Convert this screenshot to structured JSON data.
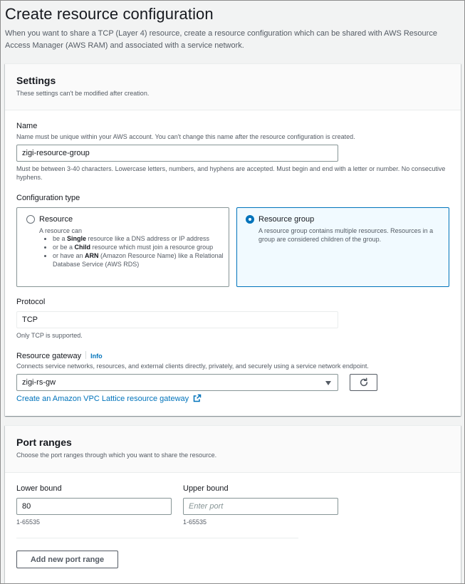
{
  "page": {
    "title": "Create resource configuration",
    "description": "When you want to share a TCP (Layer 4) resource, create a resource configuration which can be shared with AWS Resource Access Manager (AWS RAM) and associated with a service network."
  },
  "settings": {
    "title": "Settings",
    "subtitle": "These settings can't be modified after creation.",
    "name": {
      "label": "Name",
      "description": "Name must be unique within your AWS account. You can't change this name after the resource configuration is created.",
      "value": "zigi-resource-group",
      "constraint": "Must be between 3-40 characters. Lowercase letters, numbers, and hyphens are accepted. Must begin and end with a letter or number. No consecutive hyphens."
    },
    "configuration_type": {
      "label": "Configuration type",
      "options": [
        {
          "title": "Resource",
          "selected": false,
          "intro": "A resource can",
          "bullets": [
            {
              "pre": "be a ",
              "bold": "Single",
              "post": " resource like a DNS address or IP address"
            },
            {
              "pre": "or be a ",
              "bold": "Child",
              "post": " resource which must join a resource group"
            },
            {
              "pre": "or have an ",
              "bold": "ARN",
              "post": " (Amazon Resource Name) like a Relational Database Service (AWS RDS)"
            }
          ]
        },
        {
          "title": "Resource group",
          "selected": true,
          "description": "A resource group contains multiple resources. Resources in a group are considered children of the group."
        }
      ]
    },
    "protocol": {
      "label": "Protocol",
      "value": "TCP",
      "hint": "Only TCP is supported."
    },
    "resource_gateway": {
      "label": "Resource gateway",
      "info": "Info",
      "description": "Connects service networks, resources, and external clients directly, privately, and securely using a service network endpoint.",
      "value": "zigi-rs-gw",
      "create_link": "Create an Amazon VPC Lattice resource gateway"
    }
  },
  "port_ranges": {
    "title": "Port ranges",
    "subtitle": "Choose the port ranges through which you want to share the resource.",
    "lower": {
      "label": "Lower bound",
      "value": "80",
      "hint": "1-65535"
    },
    "upper": {
      "label": "Upper bound",
      "placeholder": "Enter port",
      "hint": "1-65535"
    },
    "add_button": "Add new port range"
  },
  "colors": {
    "accent": "#0073bb",
    "selected_tile_bg": "#f1faff",
    "page_bg": "#f2f3f3"
  }
}
